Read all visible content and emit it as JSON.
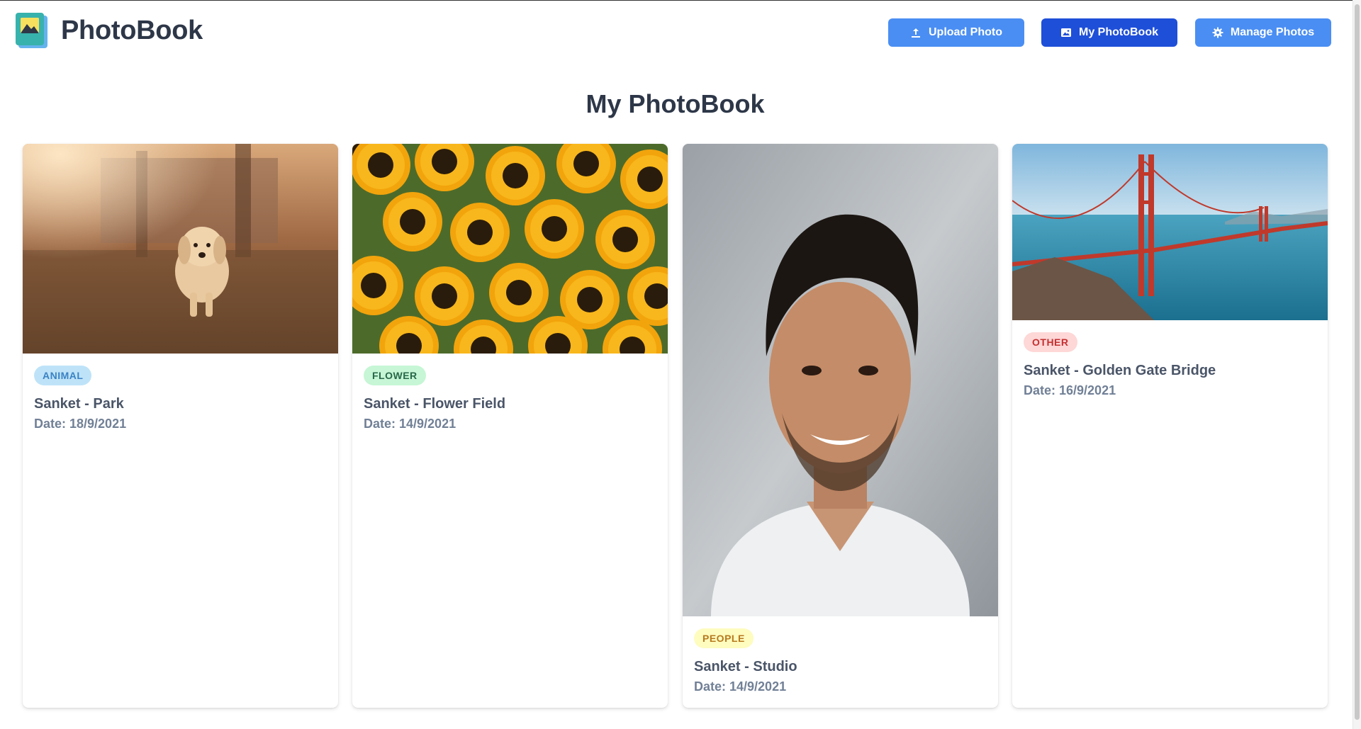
{
  "app": {
    "name": "PhotoBook"
  },
  "nav": {
    "upload_label": "Upload Photo",
    "photobook_label": "My PhotoBook",
    "manage_label": "Manage Photos"
  },
  "page": {
    "title": "My PhotoBook"
  },
  "photos": [
    {
      "category": "ANIMAL",
      "title": "Sanket - Park",
      "date": "Date: 18/9/2021"
    },
    {
      "category": "FLOWER",
      "title": "Sanket - Flower Field",
      "date": "Date: 14/9/2021"
    },
    {
      "category": "PEOPLE",
      "title": "Sanket - Studio",
      "date": "Date: 14/9/2021"
    },
    {
      "category": "OTHER",
      "title": "Sanket - Golden Gate Bridge",
      "date": "Date: 16/9/2021"
    }
  ],
  "colors": {
    "primary_button": "#4a8ef3",
    "active_button": "#1e4fd8",
    "badge_animal": "#bee3f8",
    "badge_flower": "#c6f6d5",
    "badge_people": "#fefcbf",
    "badge_other": "#fed7d7"
  },
  "icons": {
    "upload": "upload-icon",
    "photobook": "image-icon",
    "manage": "gear-icon"
  }
}
